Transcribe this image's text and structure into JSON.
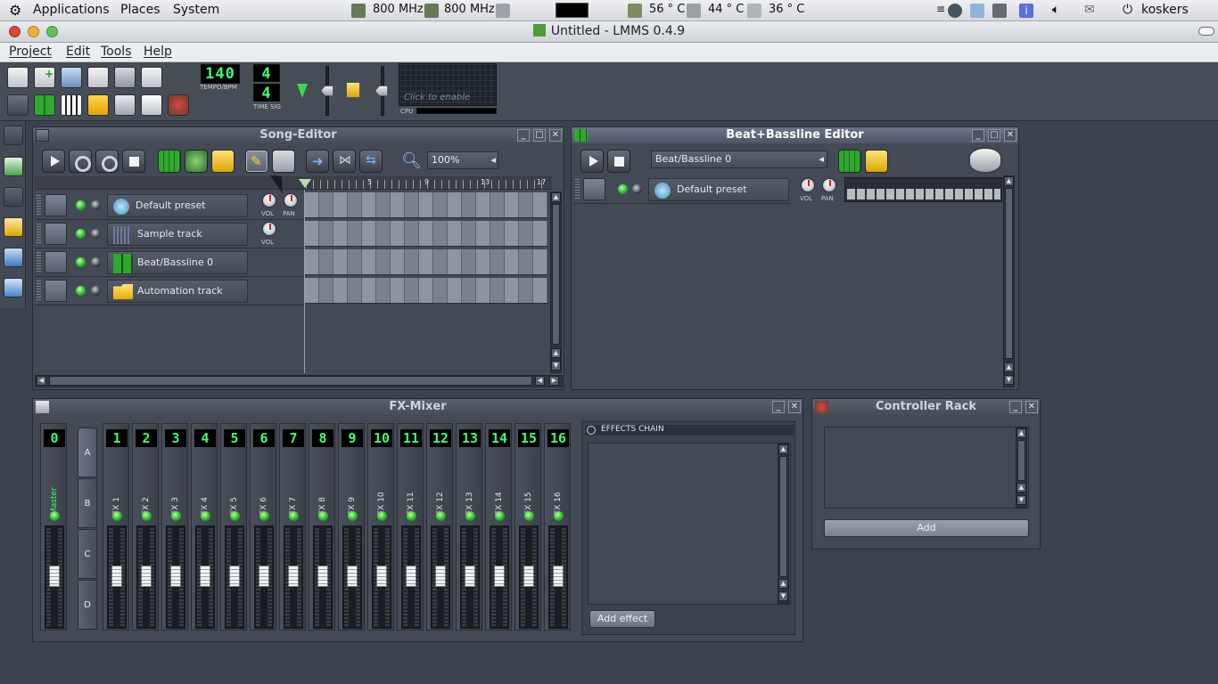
{
  "panel": {
    "menus": [
      "Applications",
      "Places",
      "System"
    ],
    "cpu_freqs": [
      "800 MHz",
      "800 MHz"
    ],
    "temps": [
      "56 ° C",
      "44 ° C",
      "36 ° C"
    ],
    "user": "koskers"
  },
  "window": {
    "title": "Untitled - LMMS 0.4.9"
  },
  "menubar": [
    "Project",
    "Edit",
    "Tools",
    "Help"
  ],
  "toolbar": {
    "tempo": "140",
    "tempo_label": "TEMPO/BPM",
    "timesig_num": "4",
    "timesig_den": "4",
    "timesig_label": "TIME SIG",
    "cpu_hint": "Click to enable",
    "cpu_label": "CPU"
  },
  "song_editor": {
    "title": "Song-Editor",
    "zoom": "100%",
    "ruler": [
      "5",
      "9",
      "13",
      "17"
    ],
    "tracks": [
      {
        "name": "Default preset",
        "knobs": [
          "VOL",
          "PAN"
        ],
        "icon": "instrument-icon"
      },
      {
        "name": "Sample track",
        "knobs": [
          "VOL"
        ],
        "icon": "sample-icon"
      },
      {
        "name": "Beat/Bassline 0",
        "knobs": [],
        "icon": "beat-bassline-icon"
      },
      {
        "name": "Automation track",
        "knobs": [],
        "icon": "folder-icon"
      }
    ]
  },
  "bb_editor": {
    "title": "Beat+Bassline Editor",
    "selected": "Beat/Bassline 0",
    "track": {
      "name": "Default preset",
      "knobs": [
        "VOL",
        "PAN"
      ]
    }
  },
  "fx_mixer": {
    "title": "FX-Mixer",
    "master": {
      "num": "0",
      "name": "Master"
    },
    "channels": [
      {
        "num": "1",
        "name": "FX 1"
      },
      {
        "num": "2",
        "name": "FX 2"
      },
      {
        "num": "3",
        "name": "FX 3"
      },
      {
        "num": "4",
        "name": "FX 4"
      },
      {
        "num": "5",
        "name": "FX 5"
      },
      {
        "num": "6",
        "name": "FX 6"
      },
      {
        "num": "7",
        "name": "FX 7"
      },
      {
        "num": "8",
        "name": "FX 8"
      },
      {
        "num": "9",
        "name": "FX 9"
      },
      {
        "num": "10",
        "name": "FX 10"
      },
      {
        "num": "11",
        "name": "FX 11"
      },
      {
        "num": "12",
        "name": "FX 12"
      },
      {
        "num": "13",
        "name": "FX 13"
      },
      {
        "num": "14",
        "name": "FX 14"
      },
      {
        "num": "15",
        "name": "FX 15"
      },
      {
        "num": "16",
        "name": "FX 16"
      }
    ],
    "banks": [
      "A",
      "B",
      "C",
      "D"
    ],
    "effects_chain_label": "EFFECTS CHAIN",
    "add_effect": "Add effect"
  },
  "controller_rack": {
    "title": "Controller Rack",
    "add": "Add"
  },
  "colors": {
    "lcd_green": "#3cff78",
    "led_green": "#2bb82b",
    "background": "#3d434e"
  }
}
